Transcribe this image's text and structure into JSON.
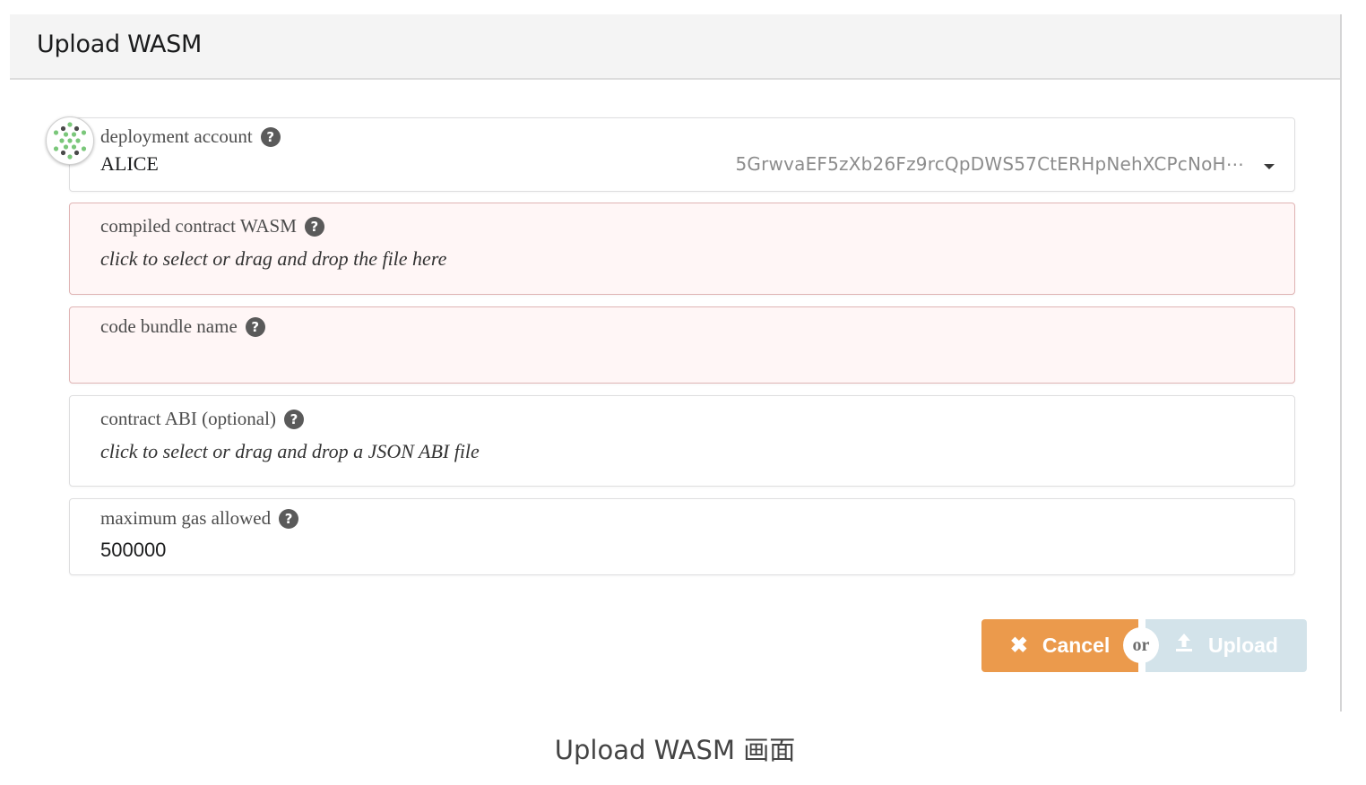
{
  "modal": {
    "title": "Upload WASM"
  },
  "fields": {
    "deployment_account": {
      "label": "deployment account",
      "name": "ALICE",
      "address": "5GrwvaEF5zXb26Fz9rcQpDWS57CtERHpNehXCPcNoH⋯",
      "help_icon": "question-circle-icon",
      "avatar_icon": "identicon",
      "dropdown_icon": "caret-down-icon"
    },
    "wasm": {
      "label": "compiled contract WASM",
      "placeholder": "click to select or drag and drop the file here",
      "help_icon": "question-circle-icon"
    },
    "bundle_name": {
      "label": "code bundle name",
      "value": "",
      "help_icon": "question-circle-icon"
    },
    "abi": {
      "label": "contract ABI (optional)",
      "placeholder": "click to select or drag and drop a JSON ABI file",
      "help_icon": "question-circle-icon"
    },
    "gas": {
      "label": "maximum gas allowed",
      "value": "500000",
      "help_icon": "question-circle-icon"
    }
  },
  "actions": {
    "cancel_label": "Cancel",
    "cancel_icon": "close-icon",
    "or_label": "or",
    "upload_label": "Upload",
    "upload_icon": "upload-icon"
  },
  "caption": "Upload WASM 画面",
  "colors": {
    "cancel": "#eb9a4c",
    "upload_disabled": "#d3e3ea",
    "error_bg": "#fff6f6",
    "error_border": "#e0b4b4"
  }
}
